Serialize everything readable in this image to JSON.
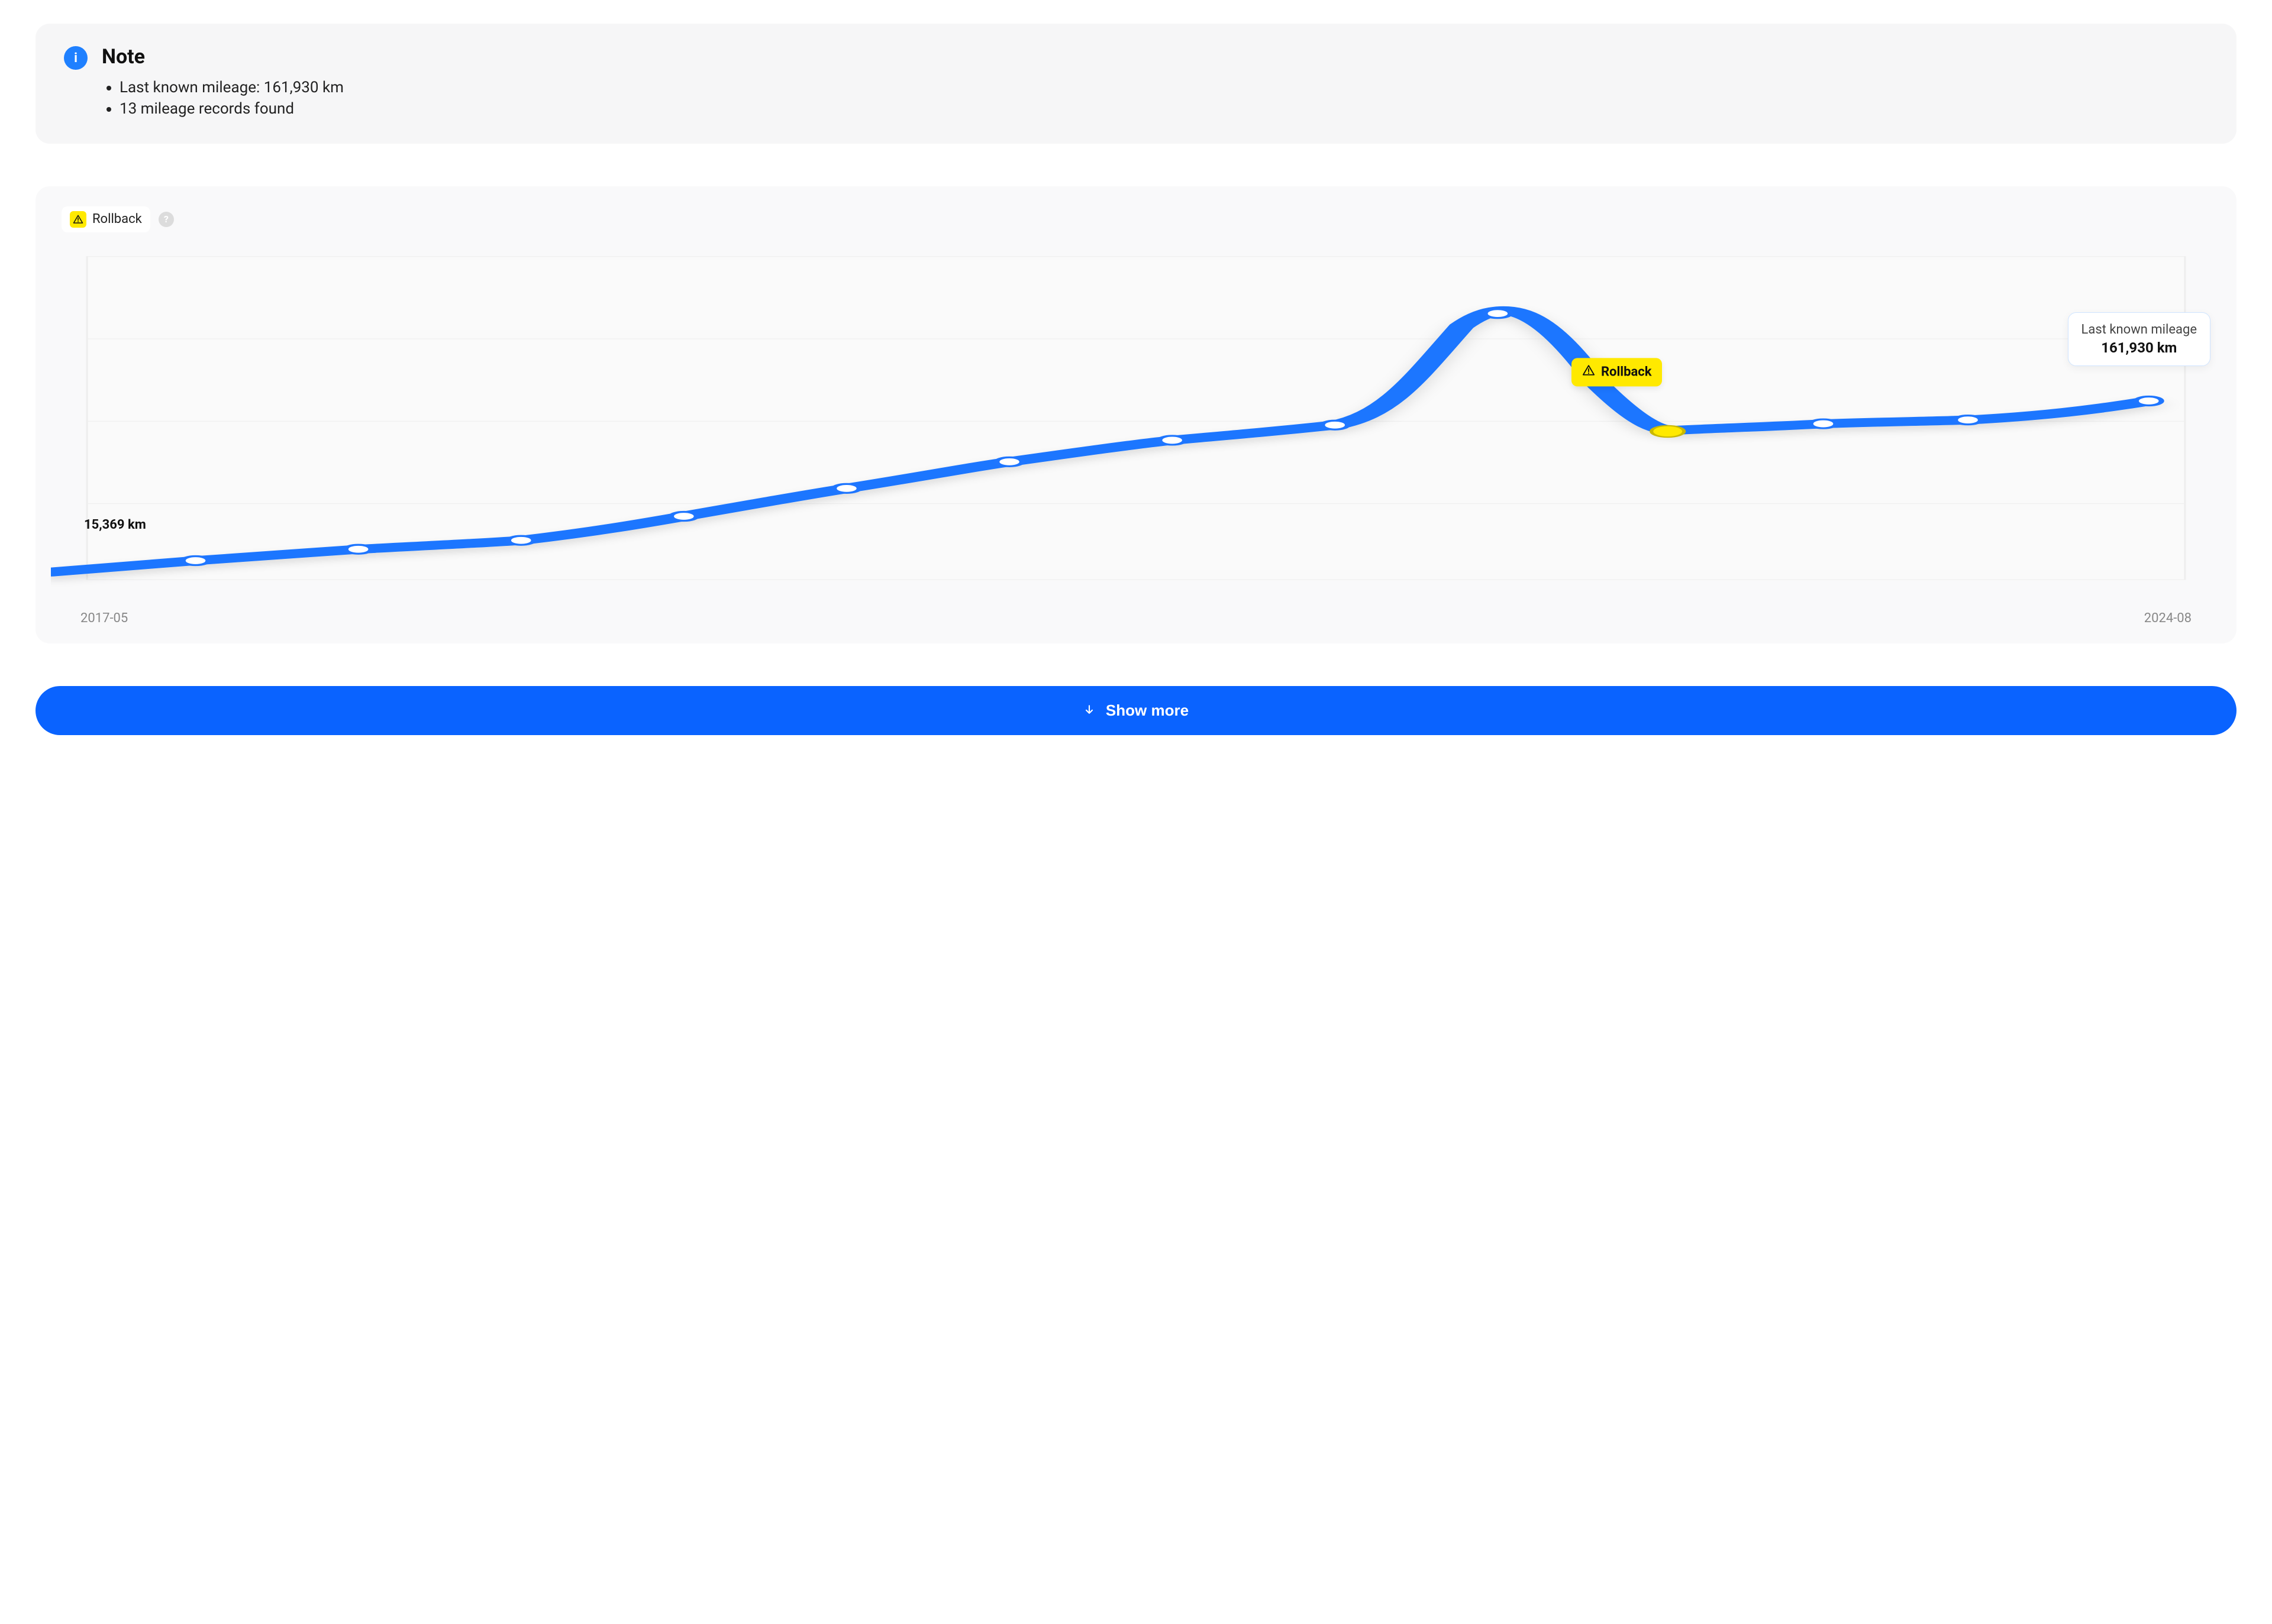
{
  "note": {
    "title": "Note",
    "items": [
      "Last known mileage: 161,930 km",
      "13 mileage records found"
    ]
  },
  "legend": {
    "rollback_label": "Rollback"
  },
  "chart": {
    "first_point_label": "15,369 km",
    "rollback_badge_label": "Rollback",
    "tooltip_title": "Last known mileage",
    "tooltip_value": "161,930 km",
    "x_start_label": "2017-05",
    "x_end_label": "2024-08"
  },
  "show_more_label": "Show more",
  "chart_data": {
    "type": "line",
    "title": "Mileage history",
    "xlabel": "",
    "ylabel": "",
    "x_range_labels": [
      "2017-05",
      "2024-08"
    ],
    "first_value_km": 15369,
    "last_value_label": "161,930 km",
    "annotations": [
      {
        "kind": "first-point-label",
        "text": "15,369 km"
      },
      {
        "kind": "last-point-tooltip",
        "title": "Last known mileage",
        "value": "161,930 km"
      },
      {
        "kind": "rollback-badge",
        "text": "Rollback",
        "point_index": 9
      }
    ],
    "series": [
      {
        "name": "mileage_km",
        "x": [
          "2017-05",
          "2017-11",
          "2018-06",
          "2019-01",
          "2019-08",
          "2020-03",
          "2020-10",
          "2021-06",
          "2022-06",
          "2022-12",
          "2023-07",
          "2024-01",
          "2024-08"
        ],
        "values": [
          15369,
          27000,
          32000,
          51000,
          69000,
          88000,
          106000,
          118000,
          130000,
          240000,
          148000,
          153000,
          157000,
          161930
        ],
        "special": {
          "rollback_index": 9
        }
      }
    ],
    "ylim": [
      0,
      260000
    ],
    "grid": true,
    "legend": [
      "Rollback"
    ]
  }
}
